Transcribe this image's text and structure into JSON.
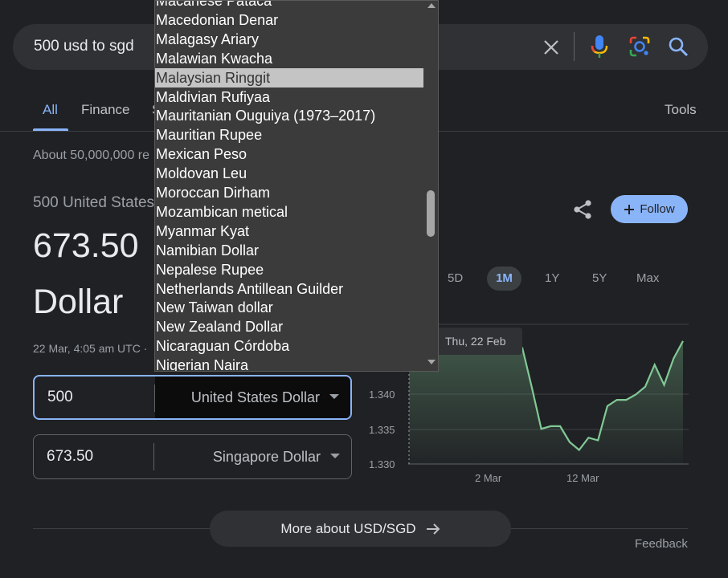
{
  "search": {
    "query": "500 usd to sgd"
  },
  "tabs": [
    {
      "label": "All"
    },
    {
      "label": "Finance"
    },
    {
      "label": "S"
    }
  ],
  "tools_label": "Tools",
  "result_stats": "About 50,000,000 re",
  "converter": {
    "from_line": "500 United States",
    "result_number": "673.50",
    "result_unit": "Dollar",
    "timestamp": "22 Mar, 4:05 am UTC ·",
    "from_amount": "500",
    "from_currency": "United States Dollar",
    "to_amount": "673.50",
    "to_currency": "Singapore Dollar",
    "follow_label": "Follow"
  },
  "ranges": [
    "5D",
    "1M",
    "1Y",
    "5Y",
    "Max"
  ],
  "active_range": "1M",
  "chart_data": {
    "type": "area",
    "tooltip": "Thu, 22 Feb",
    "x_ticks": [
      "2 Mar",
      "12 Mar"
    ],
    "y_ticks": [
      "1.340",
      "1.335",
      "1.330"
    ],
    "ylim": [
      1.3295,
      1.3454
    ],
    "y": [
      1.3426,
      1.3426,
      1.3427,
      1.343,
      1.3436,
      1.3434,
      1.3445,
      1.3445,
      1.344,
      1.344,
      1.3433,
      1.343,
      1.3427,
      1.3382,
      1.3335,
      1.3338,
      1.3338,
      1.332,
      1.3311,
      1.3325,
      1.3322,
      1.3361,
      1.3368,
      1.3368,
      1.3374,
      1.3383,
      1.3408,
      1.3385,
      1.3415,
      1.3435
    ],
    "line_color": "#81c995",
    "grid": true
  },
  "dropdown": {
    "options": [
      "Macanese Pataca",
      "Macedonian Denar",
      "Malagasy Ariary",
      "Malawian Kwacha",
      "Malaysian Ringgit",
      "Maldivian Rufiyaa",
      "Mauritanian Ouguiya (1973–2017)",
      "Mauritian Rupee",
      "Mexican Peso",
      "Moldovan Leu",
      "Moroccan Dirham",
      "Mozambican metical",
      "Myanmar Kyat",
      "Namibian Dollar",
      "Nepalese Rupee",
      "Netherlands Antillean Guilder",
      "New Taiwan dollar",
      "New Zealand Dollar",
      "Nicaraguan Córdoba",
      "Nigerian Naira"
    ],
    "selected_index": 4
  },
  "more_about": "More about USD/SGD",
  "feedback": "Feedback",
  "colors": {
    "accent": "#8ab4f8",
    "background": "#202124",
    "surface": "#303134"
  }
}
